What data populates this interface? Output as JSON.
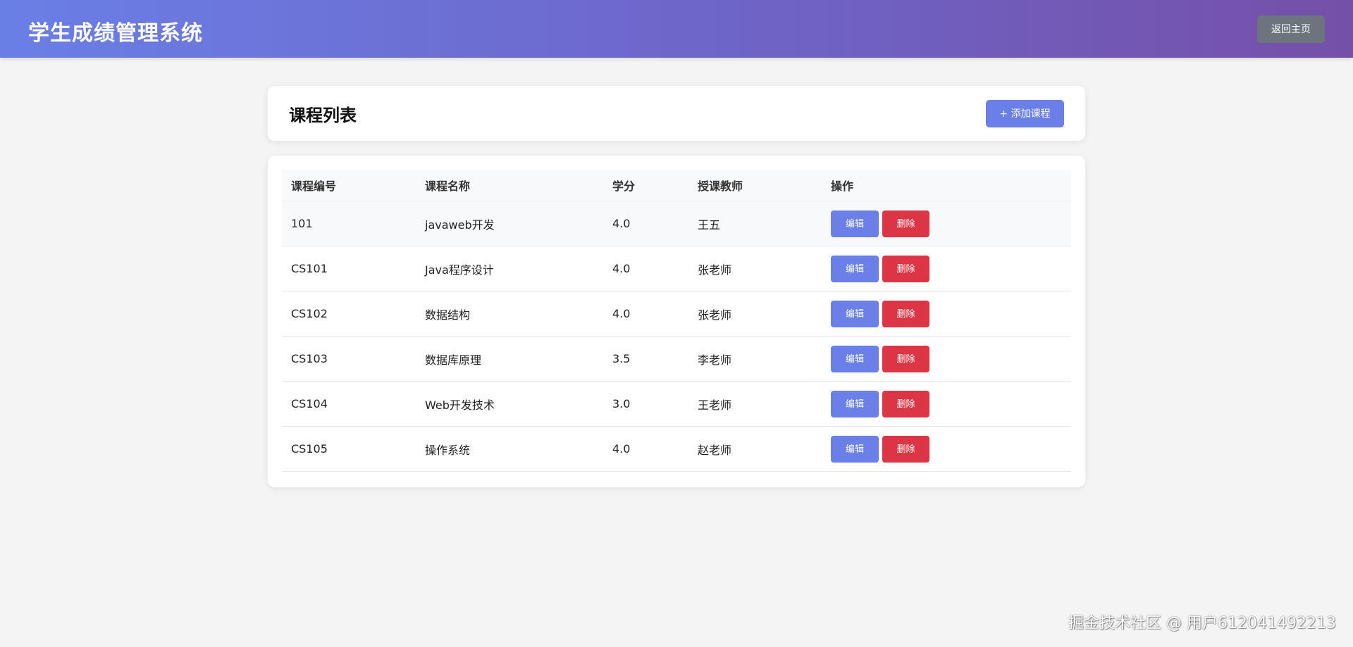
{
  "header": {
    "title": "学生成绩管理系统",
    "back_button": "返回主页"
  },
  "page": {
    "title": "课程列表",
    "add_button": "+ 添加课程"
  },
  "table": {
    "columns": [
      "课程编号",
      "课程名称",
      "学分",
      "授课教师",
      "操作"
    ],
    "rows": [
      {
        "id": "101",
        "name": "javaweb开发",
        "credit": "4.0",
        "teacher": "王五",
        "edit": "编辑",
        "delete": "删除"
      },
      {
        "id": "CS101",
        "name": "Java程序设计",
        "credit": "4.0",
        "teacher": "张老师",
        "edit": "编辑",
        "delete": "删除"
      },
      {
        "id": "CS102",
        "name": "数据结构",
        "credit": "4.0",
        "teacher": "张老师",
        "edit": "编辑",
        "delete": "删除"
      },
      {
        "id": "CS103",
        "name": "数据库原理",
        "credit": "3.5",
        "teacher": "李老师",
        "edit": "编辑",
        "delete": "删除"
      },
      {
        "id": "CS104",
        "name": "Web开发技术",
        "credit": "3.0",
        "teacher": "王老师",
        "edit": "编辑",
        "delete": "删除"
      },
      {
        "id": "CS105",
        "name": "操作系统",
        "credit": "4.0",
        "teacher": "赵老师",
        "edit": "编辑",
        "delete": "删除"
      }
    ]
  },
  "watermark": "掘金技术社区 @ 用户612041492213",
  "colors": {
    "header_gradient_start": "#6a7fe6",
    "header_gradient_end": "#7550a8",
    "primary": "#6a80e8",
    "danger": "#dc3545",
    "secondary": "#6c757d"
  }
}
